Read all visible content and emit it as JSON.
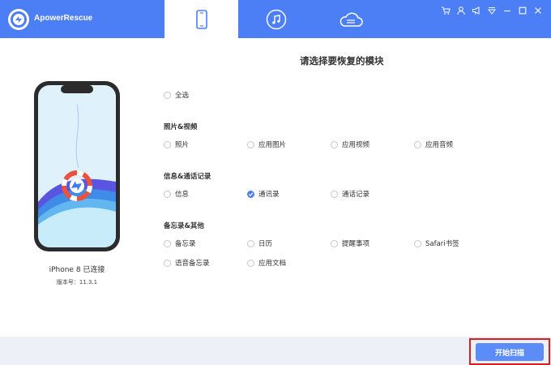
{
  "app": {
    "name": "ApowerRescue"
  },
  "tabs": [
    {
      "icon": "phone-icon",
      "active": true
    },
    {
      "icon": "music-icon",
      "active": false
    },
    {
      "icon": "cloud-icon",
      "active": false
    }
  ],
  "window_icons": [
    "cart-icon",
    "user-icon",
    "megaphone-icon",
    "dropdown-icon",
    "minimize-icon",
    "maximize-icon",
    "close-icon"
  ],
  "device": {
    "name": "iPhone 8 已连接",
    "version": "版本号：11.3.1"
  },
  "main": {
    "heading": "请选择要恢复的模块",
    "select_all": "全选",
    "sections": [
      {
        "title": "照片&视频",
        "options": [
          "照片",
          "应用图片",
          "应用视频",
          "应用音频"
        ]
      },
      {
        "title": "信息&通话记录",
        "options": [
          "信息",
          "通讯录",
          "通话记录"
        ],
        "checked": "通讯录"
      },
      {
        "title": "备忘录&其他",
        "options": [
          "备忘录",
          "日历",
          "提醒事项",
          "Safari书签",
          "语音备忘录",
          "应用文档"
        ]
      }
    ]
  },
  "footer": {
    "scan_label": "开始扫描"
  },
  "colors": {
    "accent": "#4c7ff5",
    "button": "#5b8cf7",
    "highlight": "#d81e1e"
  }
}
